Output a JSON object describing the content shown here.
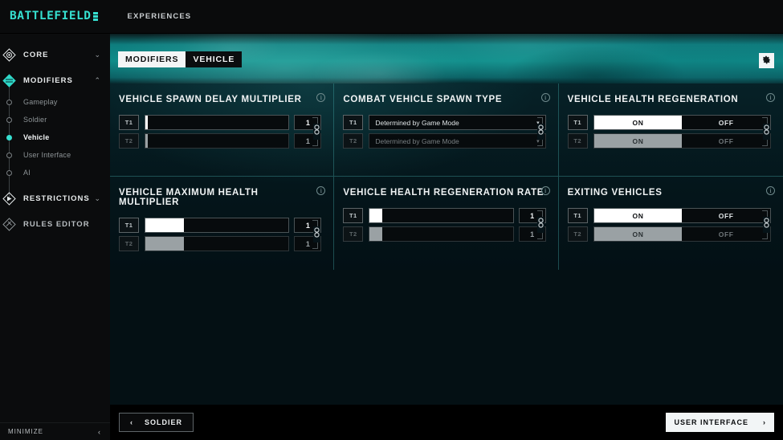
{
  "topbar": {
    "logo": "BATTLEFIELD",
    "nav": "EXPERIENCES"
  },
  "sidebar": {
    "groups": [
      {
        "label": "CORE",
        "icon": "core-diamond-icon",
        "expanded": false,
        "chevron": "⌄"
      },
      {
        "label": "MODIFIERS",
        "icon": "modifiers-diamond-icon",
        "expanded": true,
        "chevron": "⌃"
      }
    ],
    "modifier_items": [
      {
        "label": "Gameplay",
        "active": false
      },
      {
        "label": "Soldier",
        "active": false
      },
      {
        "label": "Vehicle",
        "active": true
      },
      {
        "label": "User Interface",
        "active": false
      },
      {
        "label": "AI",
        "active": false
      }
    ],
    "groups_bottom": [
      {
        "label": "RESTRICTIONS",
        "icon": "restrictions-diamond-icon",
        "chevron": "⌄"
      },
      {
        "label": "RULES EDITOR",
        "icon": "rules-editor-diamond-icon",
        "chevron": ""
      }
    ],
    "minimize": {
      "label": "MINIMIZE",
      "chevron": "‹"
    }
  },
  "header": {
    "tab_primary": "MODIFIERS",
    "tab_secondary": "VEHICLE",
    "settings_icon": "gear-icon"
  },
  "teams": {
    "t1": "T1",
    "t2": "T2"
  },
  "cards": [
    {
      "title": "VEHICLE SPAWN DELAY MULTIPLIER",
      "type": "slider",
      "info": "i",
      "rows": [
        {
          "team": "T1",
          "fill_percent": 1.5,
          "value": "1"
        },
        {
          "team": "T2",
          "fill_percent": 1.5,
          "value": "1"
        }
      ],
      "link_icon": "chain-link-icon"
    },
    {
      "title": "COMBAT VEHICLE SPAWN TYPE",
      "type": "dropdown",
      "info": "i",
      "rows": [
        {
          "team": "T1",
          "value": "Determined by Game Mode"
        },
        {
          "team": "T2",
          "value": "Determined by Game Mode"
        }
      ],
      "chevron": "▾",
      "link_icon": "chain-link-icon"
    },
    {
      "title": "VEHICLE HEALTH REGENERATION",
      "type": "toggle",
      "info": "i",
      "options": [
        "ON",
        "OFF"
      ],
      "rows": [
        {
          "team": "T1",
          "selected": "ON"
        },
        {
          "team": "T2",
          "selected": "ON"
        }
      ],
      "link_icon": "chain-link-icon"
    },
    {
      "title": "VEHICLE MAXIMUM HEALTH MULTIPLIER",
      "type": "slider",
      "info": "i",
      "rows": [
        {
          "team": "T1",
          "fill_percent": 27,
          "value": "1"
        },
        {
          "team": "T2",
          "fill_percent": 27,
          "value": "1"
        }
      ],
      "link_icon": "chain-link-icon"
    },
    {
      "title": "VEHICLE HEALTH REGENERATION RATE",
      "type": "slider",
      "info": "i",
      "rows": [
        {
          "team": "T1",
          "fill_percent": 9,
          "value": "1"
        },
        {
          "team": "T2",
          "fill_percent": 9,
          "value": "1"
        }
      ],
      "link_icon": "chain-link-icon"
    },
    {
      "title": "EXITING VEHICLES",
      "type": "toggle",
      "info": "i",
      "options": [
        "ON",
        "OFF"
      ],
      "rows": [
        {
          "team": "T1",
          "selected": "ON"
        },
        {
          "team": "T2",
          "selected": "ON"
        }
      ],
      "link_icon": "chain-link-icon"
    }
  ],
  "footer": {
    "prev_label": "SOLDIER",
    "prev_icon": "chevron-left-icon",
    "prev_chevron": "‹",
    "next_label": "USER INTERFACE",
    "next_icon": "chevron-right-icon",
    "next_chevron": "›"
  },
  "colors": {
    "accent": "#37dfd0",
    "teal_header": "#0c8a87",
    "card_bg": "#04151a",
    "white": "#ffffff"
  }
}
